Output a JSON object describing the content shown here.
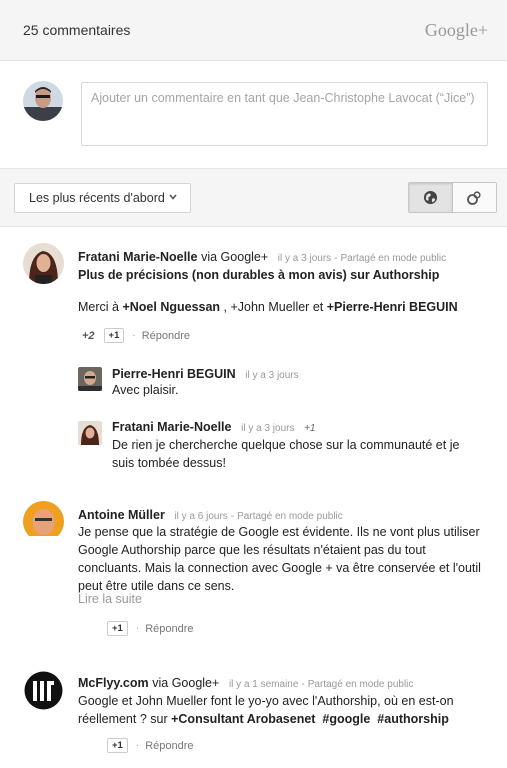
{
  "header": {
    "count_label": "25 commentaires",
    "brand": "Google+"
  },
  "composer": {
    "placeholder": "Ajouter un commentaire en tant que Jean-Christophe Lavocat (“Jice”)"
  },
  "toolbar": {
    "sort_label": "Les plus récents d'abord",
    "icons": {
      "sort": "chevron-down-icon",
      "public": "globe-icon",
      "circles": "circles-icon"
    }
  },
  "labels": {
    "plus_one": "+1",
    "reply": "Répondre",
    "separator": "·",
    "read_more": "Lire la suite",
    "meta_dot": "-"
  },
  "comments": [
    {
      "author": "Fratani Marie-Noelle",
      "via": "via Google+",
      "time": "il y a 3 jours",
      "visibility": "Partagé en mode public",
      "title": "Plus de précisions (non durables à mon avis) sur Authorship",
      "text_prefix": "Merci à ",
      "mention1": "+Noel Nguessan",
      "text_mid1": " , +John Mueller et ",
      "mention2": "+Pierre-Henri BEGUIN",
      "plus_count": "+2",
      "replies": [
        {
          "author": "Pierre-Henri BEGUIN",
          "time": "il y a 3 jours",
          "text": "Avec plaisir."
        },
        {
          "author": "Fratani Marie-Noelle",
          "time": "il y a 3 jours",
          "plus": "+1",
          "text": "De rien je chercherche quelque chose sur la communauté et je suis tombée dessus!"
        }
      ]
    },
    {
      "author": "Antoine Müller",
      "time": "il y a 6 jours",
      "visibility": "Partagé en mode public",
      "text": "Je pense que la stratégie de Google est évidente. Ils ne vont plus utiliser Google Authorship parce que les résultats n'étaient pas du tout concluants. Mais la connection avec Google + va être conservée et l'outil peut être utile dans ce sens."
    },
    {
      "author": "McFlyy.com",
      "via": "via Google+",
      "time": "il y a 1 semaine",
      "visibility": "Partagé en mode public",
      "text_prefix": "Google et John Mueller font le yo-yo avec l'Authorship, où en est-on réellement ? sur ",
      "mention1": "+Consultant Arobasenet",
      "hashtag1": "#google",
      "hashtag2": "#authorship"
    }
  ]
}
